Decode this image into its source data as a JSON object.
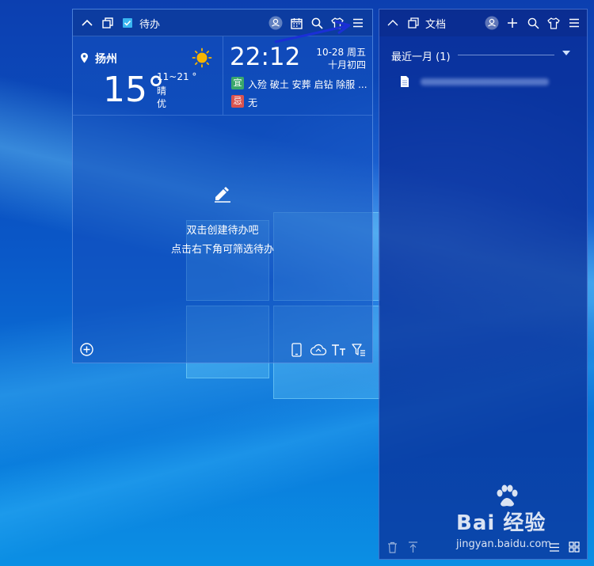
{
  "todo_widget": {
    "title": "待办",
    "weather": {
      "city": "扬州",
      "temperature": "15°",
      "range": "11~21 °",
      "condition": "晴",
      "air_quality": "优"
    },
    "datetime": {
      "time": "22:12",
      "date": "10-28 周五",
      "lunar": "十月初四",
      "yi_tag": "宜",
      "yi_text": "入殓 破土 安葬 启钻 除服 ...",
      "ji_tag": "忌",
      "ji_text": "无"
    },
    "empty_state": {
      "line1": "双击创建待办吧",
      "line2": "点击右下角可筛选待办"
    },
    "icons": {
      "collapse": "chevron-up-icon",
      "window": "window-icon",
      "todo": "todo-check-icon",
      "user": "user-icon",
      "calendar": "calendar-icon",
      "search": "search-icon",
      "skin": "shirt-icon",
      "menu": "menu-icon",
      "add": "add-circle-icon",
      "phone": "phone-icon",
      "cloud": "cloud-sync-icon",
      "font": "font-size-icon",
      "filter": "filter-icon"
    },
    "colors": {
      "yi": "#3aa86b",
      "ji": "#d9534f",
      "sun": "#f7b500",
      "annotation_arrow": "#1a2fd6"
    }
  },
  "docs_widget": {
    "title": "文档",
    "group_label": "最近一月 (1)",
    "icons": {
      "collapse": "chevron-up-icon",
      "window": "window-icon",
      "user": "user-icon",
      "add": "plus-icon",
      "search": "search-icon",
      "skin": "shirt-icon",
      "menu": "menu-icon",
      "group_toggle": "caret-down-icon",
      "document": "document-icon",
      "trash": "trash-icon",
      "upload": "upload-icon",
      "list": "list-view-icon",
      "grid": "grid-view-icon"
    }
  },
  "watermark": {
    "brand": "Bai 经验",
    "url": "jingyan.baidu.com"
  }
}
